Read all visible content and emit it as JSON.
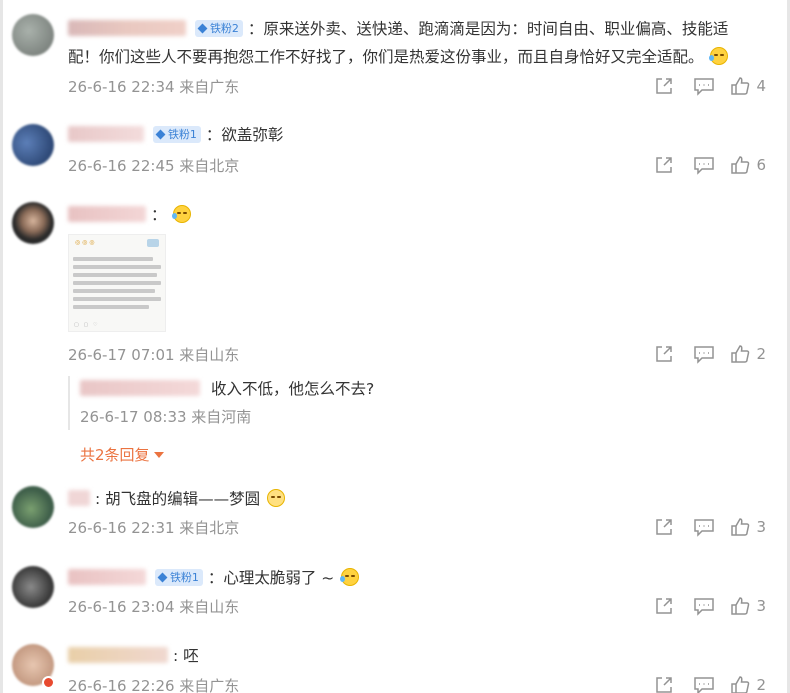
{
  "colors": {
    "badge_bg": "#dbe9fb",
    "badge_text": "#3b82d6",
    "meta": "#939393",
    "expand": "#eb7340"
  },
  "icons": {
    "share": "share-icon",
    "comment": "comment-icon",
    "like": "like-icon"
  },
  "comments": [
    {
      "badge": "铁粉2",
      "text": "：原来送外卖、送快递、跑滴滴是因为：时间自由、职业偏高、技能适",
      "text2": "配！你们这些人不要再抱怨工作不好找了，你们是热爱这份事业，而且自身恰好又完全适配。",
      "time": "26-6-16 22:34 来自广东",
      "likes": "4"
    },
    {
      "badge": "铁粉1",
      "text": "：欲盖弥彰",
      "time": "26-6-16 22:45 来自北京",
      "likes": "6"
    },
    {
      "badge": "",
      "text": "：",
      "time": "26-6-17 07:01 来自山东",
      "likes": "2",
      "reply_text": "收入不低，他怎么不去?",
      "reply_time": "26-6-17 08:33 来自河南",
      "expand_label": "共2条回复"
    },
    {
      "badge": "",
      "text": ": 胡飞盘的编辑——梦圆",
      "time": "26-6-16 22:31 来自北京",
      "likes": "3"
    },
    {
      "badge": "铁粉1",
      "text": "：心理太脆弱了 ~",
      "time": "26-6-16 23:04 来自山东",
      "likes": "3"
    },
    {
      "badge": "",
      "text": ": 呸",
      "time": "26-6-16 22:26 来自广东",
      "likes": "2"
    }
  ]
}
